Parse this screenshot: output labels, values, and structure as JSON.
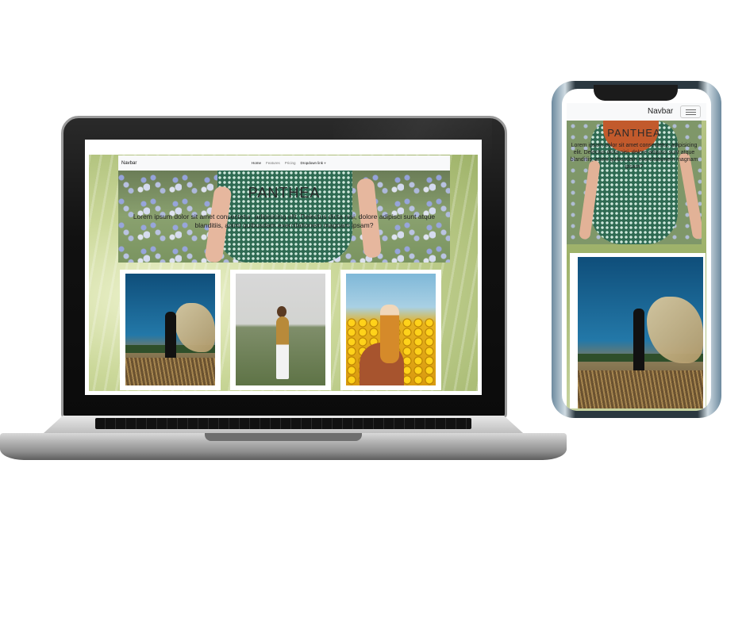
{
  "laptop_site": {
    "navbar": {
      "brand": "Navbar",
      "links": [
        "Home",
        "Features",
        "Pricing",
        "Dropdown link"
      ],
      "dropdown_icon": "caret-down-icon"
    },
    "hero": {
      "title": "PANTHEA",
      "text": "Lorem ipsum dolor sit amet consectetur, adipisicing elit. Delectus dicta nisi, dolore adipisci sunt atque blanditiis, animi quibusdam exercitationem magnam ipsam?"
    },
    "gallery": [
      {
        "alt": "woman-with-scarf-photo"
      },
      {
        "alt": "woman-in-field-photo"
      },
      {
        "alt": "woman-in-flowers-photo"
      }
    ]
  },
  "phone_site": {
    "navbar": {
      "brand": "Navbar",
      "toggler_icon": "hamburger-menu-icon"
    },
    "hero": {
      "title": "PANTHEA",
      "text": "Lorem ipsum dolor sit amet consectetur, adipisicing elit. Delectus dicta nisi, dolore adipisci sunt atque blanditiis, animi quibusdam exercitationem magnam ipsam?"
    }
  }
}
